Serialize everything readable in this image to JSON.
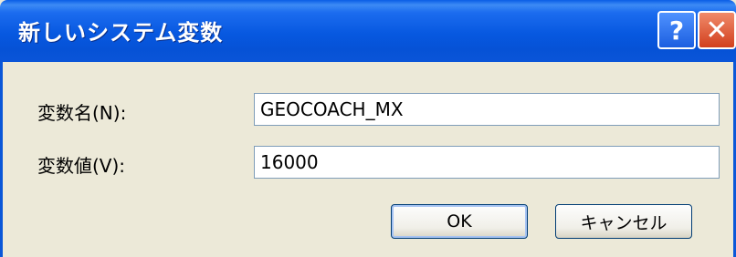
{
  "window": {
    "title": "新しいシステム変数",
    "help_symbol": "?",
    "close_symbol": "✕"
  },
  "form": {
    "name_label": "変数名(N):",
    "name_value": "GEOCOACH_MX",
    "value_label": "変数値(V):",
    "value_value": "16000"
  },
  "buttons": {
    "ok": "OK",
    "cancel": "キャンセル"
  },
  "colors": {
    "titlebar": "#0758e0",
    "dialog_bg": "#ece9d8",
    "close_button": "#d2401e"
  }
}
